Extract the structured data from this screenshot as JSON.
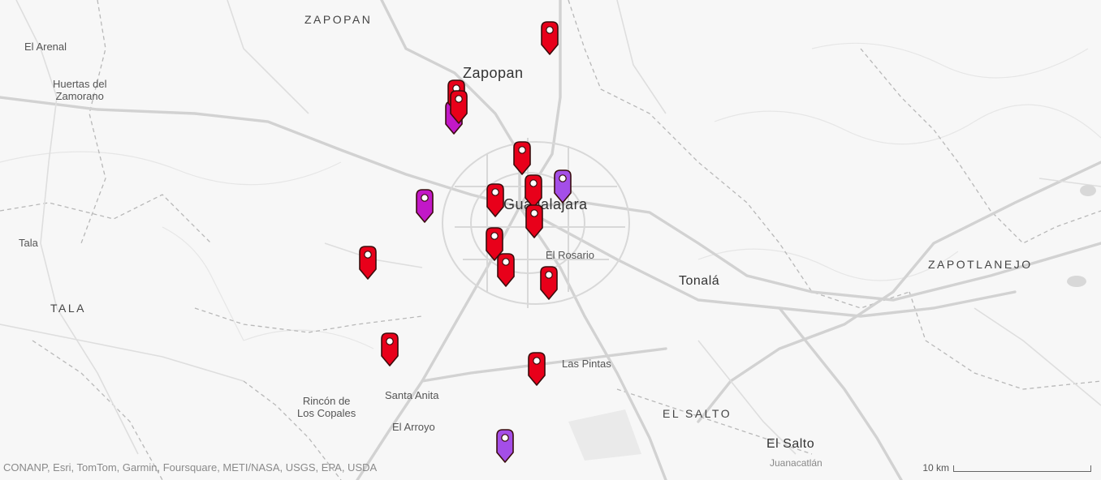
{
  "map": {
    "place_labels": [
      {
        "id": "zapopan-muni",
        "text": "ZAPOPAN",
        "style": "muni"
      },
      {
        "id": "el-arenal",
        "text": "El Arenal",
        "style": "small"
      },
      {
        "id": "huertas",
        "text": "Huertas del\nZamorano",
        "style": "small"
      },
      {
        "id": "zapopan-city",
        "text": "Zapopan",
        "style": "city"
      },
      {
        "id": "guadalajara",
        "text": "Guadalajara",
        "style": "city"
      },
      {
        "id": "el-rosario",
        "text": "El Rosario",
        "style": "small"
      },
      {
        "id": "tonala",
        "text": "Tonalá",
        "style": "city"
      },
      {
        "id": "zapotlanejo",
        "text": "ZAPOTLANEJO",
        "style": "muni"
      },
      {
        "id": "tala-town",
        "text": "Tala",
        "style": "small"
      },
      {
        "id": "tala-muni",
        "text": "TALA",
        "style": "muni"
      },
      {
        "id": "las-pintas",
        "text": "Las Pintas",
        "style": "small"
      },
      {
        "id": "rincon",
        "text": "Rincón de\nLos Copales",
        "style": "small"
      },
      {
        "id": "santa-anita",
        "text": "Santa Anita",
        "style": "small"
      },
      {
        "id": "el-arroyo",
        "text": "El Arroyo",
        "style": "small"
      },
      {
        "id": "el-salto-muni",
        "text": "EL SALTO",
        "style": "muni"
      },
      {
        "id": "el-salto-city",
        "text": "El Salto",
        "style": "city"
      },
      {
        "id": "juanacatlan",
        "text": "Juanacatlán",
        "style": "small"
      }
    ],
    "markers": [
      {
        "color": "red"
      },
      {
        "color": "magenta"
      },
      {
        "color": "red"
      },
      {
        "color": "red"
      },
      {
        "color": "red"
      },
      {
        "color": "purple"
      },
      {
        "color": "magenta"
      },
      {
        "color": "red"
      },
      {
        "color": "red"
      },
      {
        "color": "red"
      },
      {
        "color": "red"
      },
      {
        "color": "red"
      },
      {
        "color": "red"
      },
      {
        "color": "red"
      },
      {
        "color": "red"
      },
      {
        "color": "red"
      },
      {
        "color": "purple"
      }
    ],
    "marker_colors": {
      "red": "#e8001a",
      "magenta": "#c218c8",
      "purple": "#a44ee8",
      "outline": "#3a0d0d"
    },
    "attribution": "CONANP, Esri, TomTom, Garmin, Foursquare, METI/NASA, USGS, EPA, USDA",
    "scale_label": "10 km"
  }
}
